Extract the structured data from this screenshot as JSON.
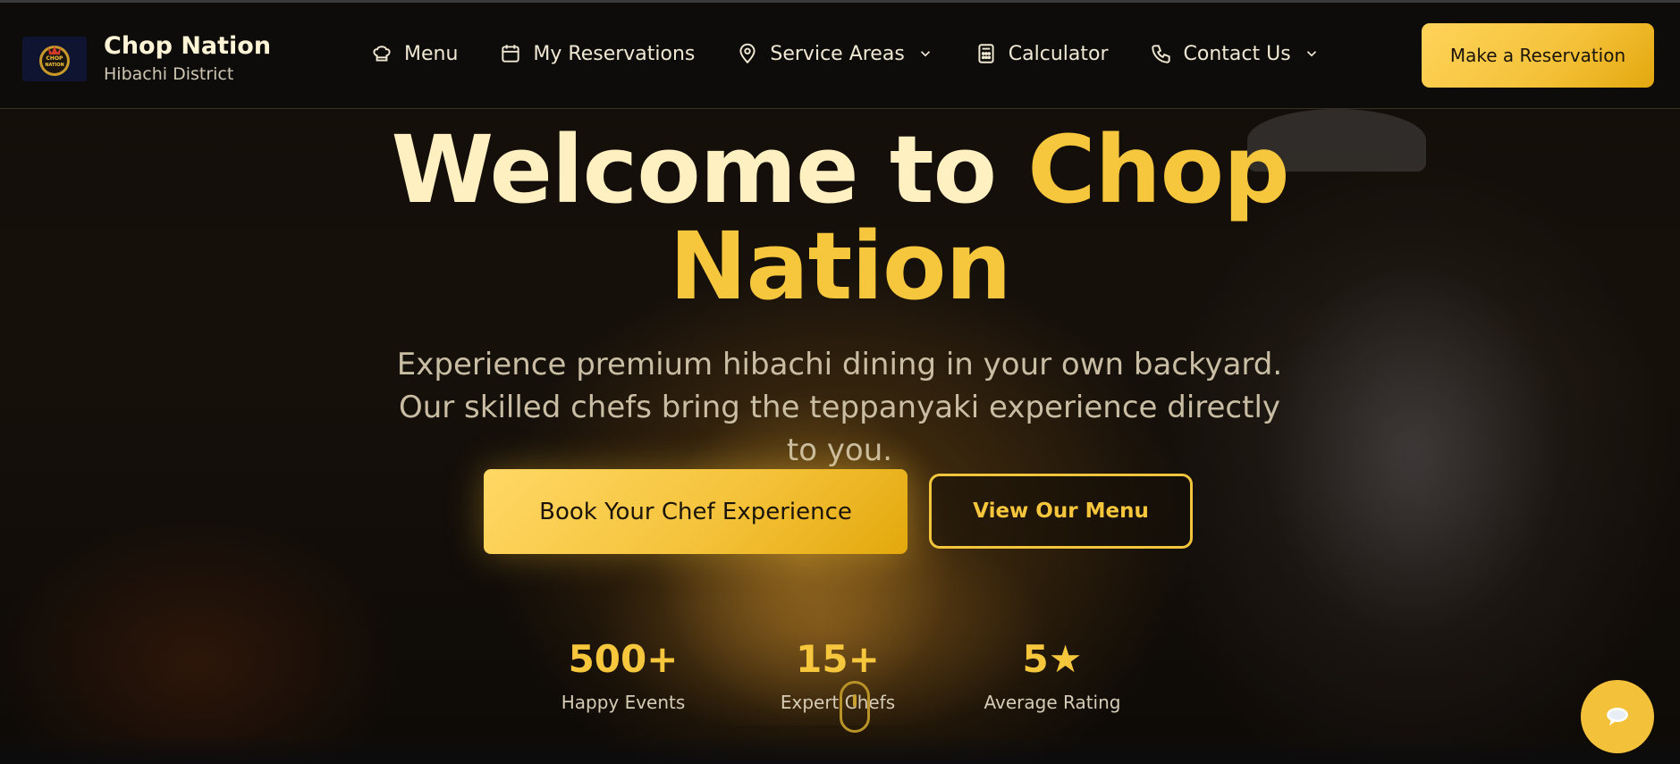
{
  "header": {
    "brand_name": "Chop Nation",
    "brand_sub": "Hibachi District",
    "logo_text_top": "CHOP",
    "logo_text_bottom": "NATION",
    "nav": [
      {
        "label": "Menu",
        "icon": "chef-hat-icon"
      },
      {
        "label": "My Reservations",
        "icon": "calendar-icon"
      },
      {
        "label": "Service Areas",
        "icon": "map-pin-icon",
        "dropdown": true
      },
      {
        "label": "Calculator",
        "icon": "calculator-icon"
      },
      {
        "label": "Contact Us",
        "icon": "phone-icon",
        "dropdown": true
      }
    ],
    "cta_label": "Make a Reservation"
  },
  "hero": {
    "title_light": "Welcome to ",
    "title_gold_1": "Chop",
    "title_gold_2": "Nation",
    "subtitle": "Experience premium hibachi dining in your own backyard. Our skilled chefs bring the teppanyaki experience directly to you.",
    "primary_cta": "Book Your Chef Experience",
    "secondary_cta": "View Our Menu",
    "stats": [
      {
        "value": "500+",
        "label": "Happy Events"
      },
      {
        "value": "15+",
        "label": "Expert Chefs"
      },
      {
        "value": "5★",
        "label": "Average Rating"
      }
    ]
  },
  "colors": {
    "accent": "#f6c63c",
    "header_bg": "#0d0c0b",
    "text_light": "#fff0c2"
  }
}
